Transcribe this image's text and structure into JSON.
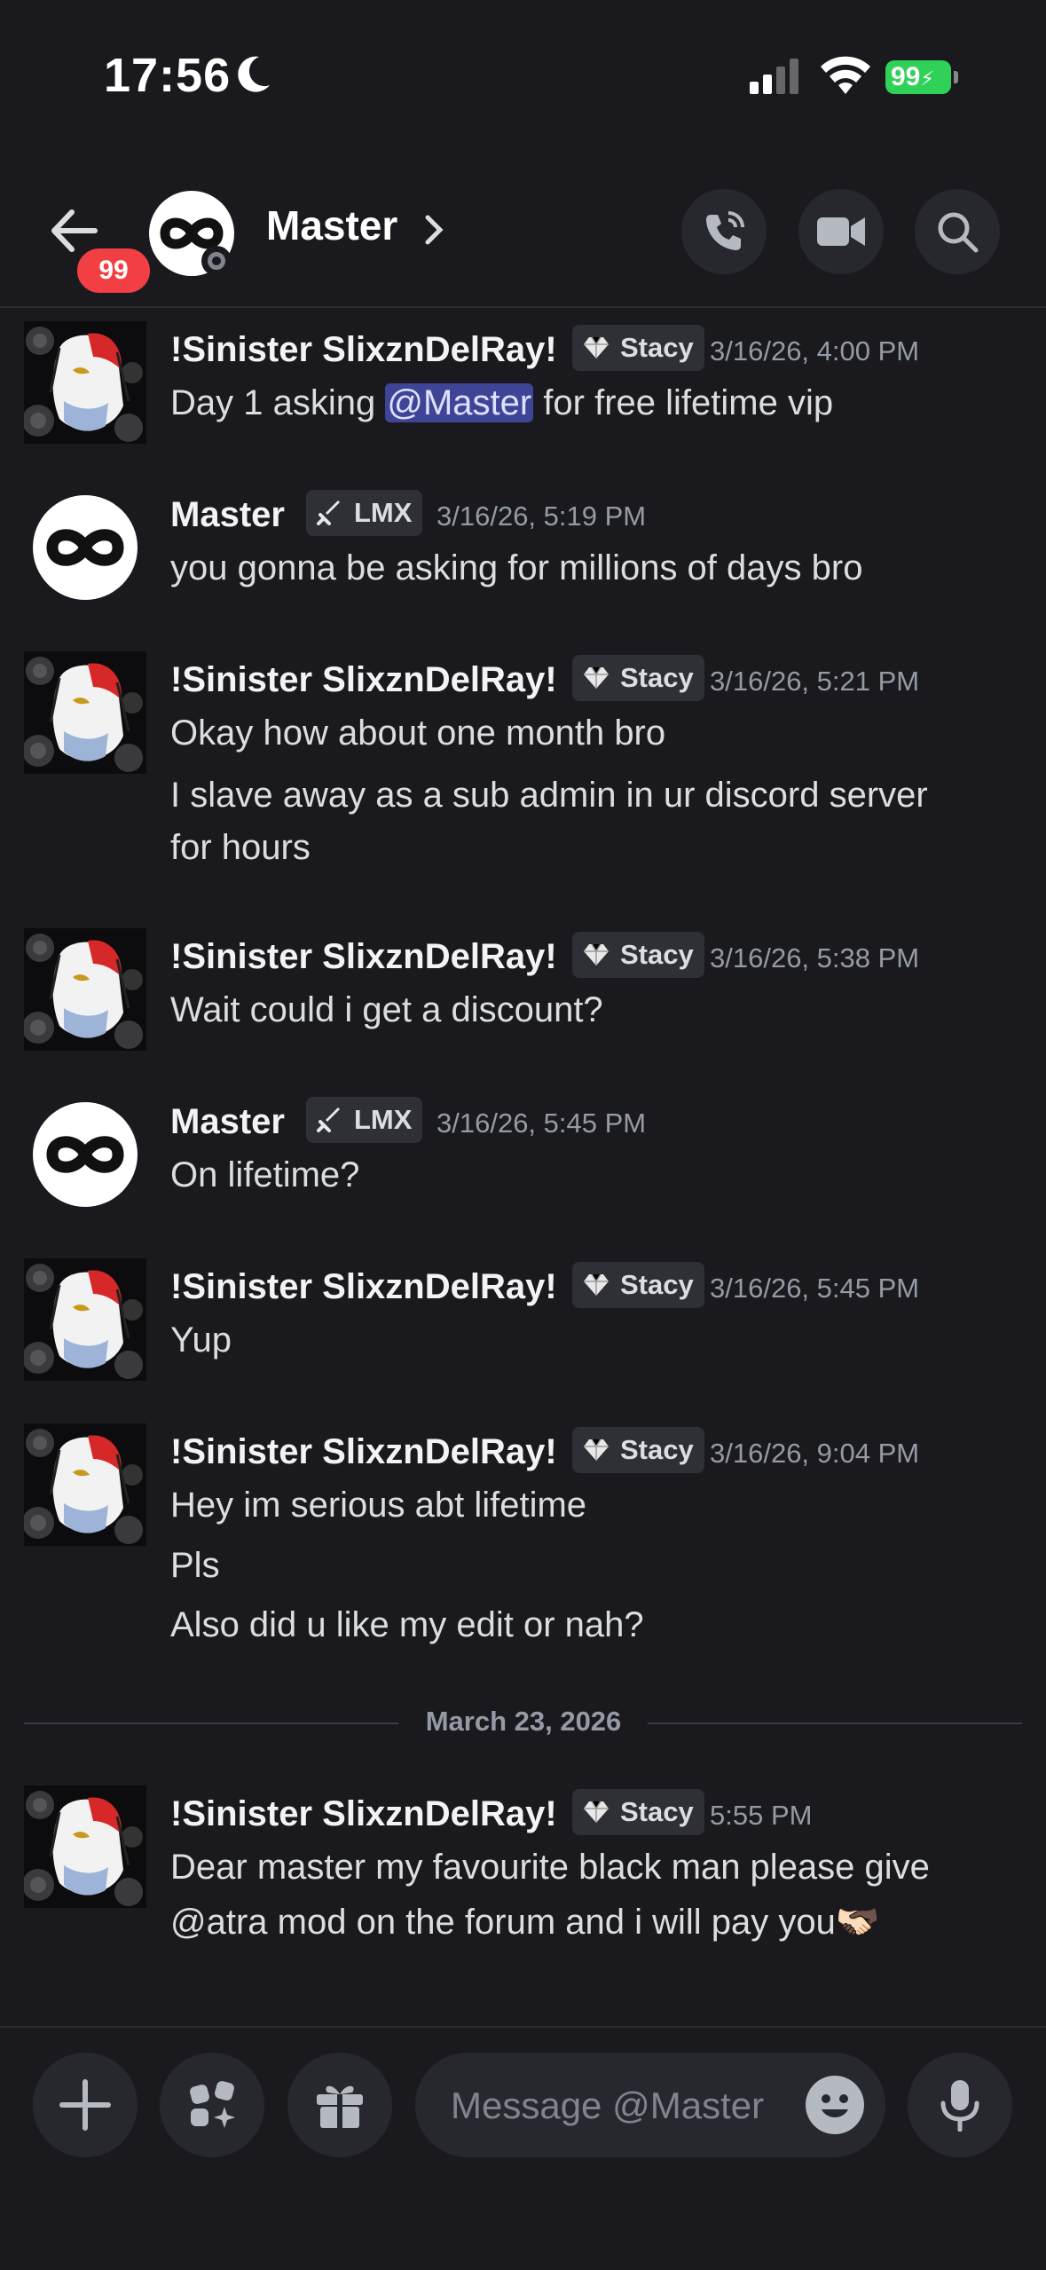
{
  "status_bar": {
    "time": "17:56",
    "battery": "99"
  },
  "header": {
    "back_badge": "99",
    "title": "Master"
  },
  "tags": {
    "stacy": "Stacy",
    "lmx": "LMX"
  },
  "messages": [
    {
      "author": "!Sinister SlixznDelRay!",
      "tag": "Stacy",
      "time": "3/16/26, 4:00 PM",
      "lines_pre": "Day 1 asking ",
      "mention": "@Master",
      "lines_post": " for free lifetime vip"
    },
    {
      "author": "Master",
      "tag": "LMX",
      "time": "3/16/26, 5:19 PM",
      "lines": [
        "you gonna be asking for millions of days bro"
      ]
    },
    {
      "author": "!Sinister SlixznDelRay!",
      "tag": "Stacy",
      "time": "3/16/26, 5:21 PM",
      "lines": [
        "Okay how about one month bro",
        "I slave away as a sub admin in ur discord server",
        "for hours"
      ]
    },
    {
      "author": "!Sinister SlixznDelRay!",
      "tag": "Stacy",
      "time": "3/16/26, 5:38 PM",
      "lines": [
        "Wait could i get a discount?"
      ]
    },
    {
      "author": "Master",
      "tag": "LMX",
      "time": "3/16/26, 5:45 PM",
      "lines": [
        "On lifetime?"
      ]
    },
    {
      "author": "!Sinister SlixznDelRay!",
      "tag": "Stacy",
      "time": "3/16/26, 5:45 PM",
      "lines": [
        "Yup"
      ]
    },
    {
      "author": "!Sinister SlixznDelRay!",
      "tag": "Stacy",
      "time": "3/16/26, 9:04 PM",
      "lines": [
        "Hey im serious abt lifetime",
        "Pls",
        "Also did u like my edit or nah?"
      ]
    },
    {
      "author": "!Sinister SlixznDelRay!",
      "tag": "Stacy",
      "time": "5:55 PM",
      "lines": [
        "Dear master my favourite black man please give",
        "@atra mod on the forum and i will pay you🫱🏻‍🫲🏿"
      ]
    }
  ],
  "date_divider": "March 23, 2026",
  "composer": {
    "placeholder": "Message @Master"
  }
}
